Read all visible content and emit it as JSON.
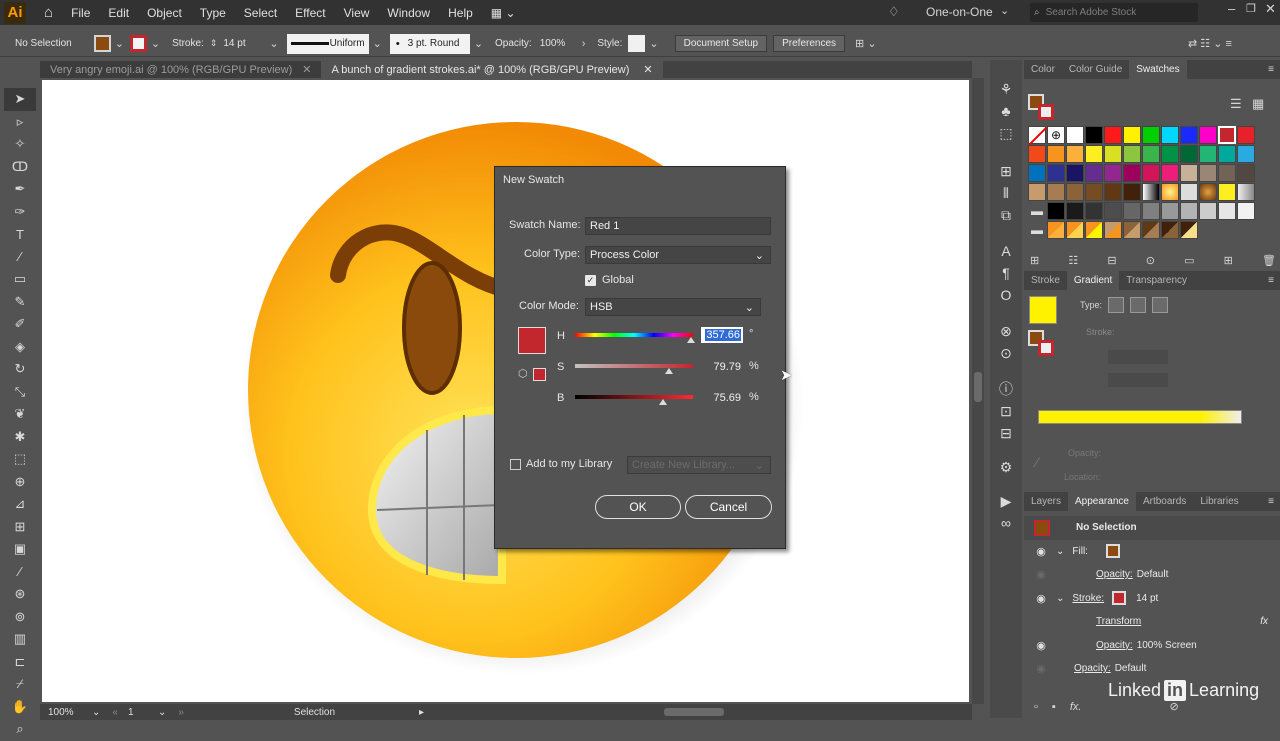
{
  "app": {
    "logo": "Ai",
    "workspace": "One-on-One",
    "search_placeholder": "Search Adobe Stock"
  },
  "menu": [
    "File",
    "Edit",
    "Object",
    "Type",
    "Select",
    "Effect",
    "View",
    "Window",
    "Help"
  ],
  "control": {
    "selection": "No Selection",
    "stroke_label": "Stroke:",
    "stroke_weight": "14 pt",
    "profile": "Uniform",
    "brush": "3 pt. Round",
    "opacity_label": "Opacity:",
    "opacity": "100%",
    "style_label": "Style:",
    "document_setup": "Document Setup",
    "preferences": "Preferences"
  },
  "tabs": [
    {
      "label": "Very angry emoji.ai @ 100% (RGB/GPU Preview)"
    },
    {
      "label": "A bunch of gradient strokes.ai* @ 100% (RGB/GPU Preview)"
    }
  ],
  "dialog": {
    "title": "New Swatch",
    "name_label": "Swatch Name:",
    "name_value": "Red 1",
    "type_label": "Color Type:",
    "type_value": "Process Color",
    "global_label": "Global",
    "mode_label": "Color Mode:",
    "mode_value": "HSB",
    "h_label": "H",
    "h_value": "357.66",
    "h_unit": "°",
    "s_label": "S",
    "s_value": "79.79",
    "s_unit": "%",
    "b_label": "B",
    "b_value": "75.69",
    "b_unit": "%",
    "library_label": "Add to my Library",
    "library_placeholder": "Create New Library...",
    "ok": "OK",
    "cancel": "Cancel",
    "swatch_color": "#c1272d"
  },
  "swatches_panel": {
    "tabs": [
      "Color",
      "Color Guide",
      "Swatches"
    ]
  },
  "gradient_panel": {
    "tabs": [
      "Stroke",
      "Gradient",
      "Transparency"
    ],
    "type_label": "Type:",
    "stroke_label": "Stroke:",
    "opacity_label": "Opacity:",
    "location_label": "Location:"
  },
  "appearance_panel": {
    "tabs": [
      "Layers",
      "Appearance",
      "Artboards",
      "Libraries"
    ],
    "title": "No Selection",
    "rows": [
      {
        "label": "Fill:",
        "value": ""
      },
      {
        "label": "Opacity:",
        "value": "Default"
      },
      {
        "label": "Stroke:",
        "value": "14 pt"
      },
      {
        "label": "Transform",
        "value": ""
      },
      {
        "label": "Opacity:",
        "value": "100% Screen"
      },
      {
        "label": "Opacity:",
        "value": "Default"
      }
    ]
  },
  "status": {
    "zoom": "100%",
    "artboard": "1",
    "tool": "Selection"
  },
  "watermark": "Linked Learning",
  "watermark_brand": "Linked",
  "watermark_in": "in",
  "watermark_word": "Learning"
}
